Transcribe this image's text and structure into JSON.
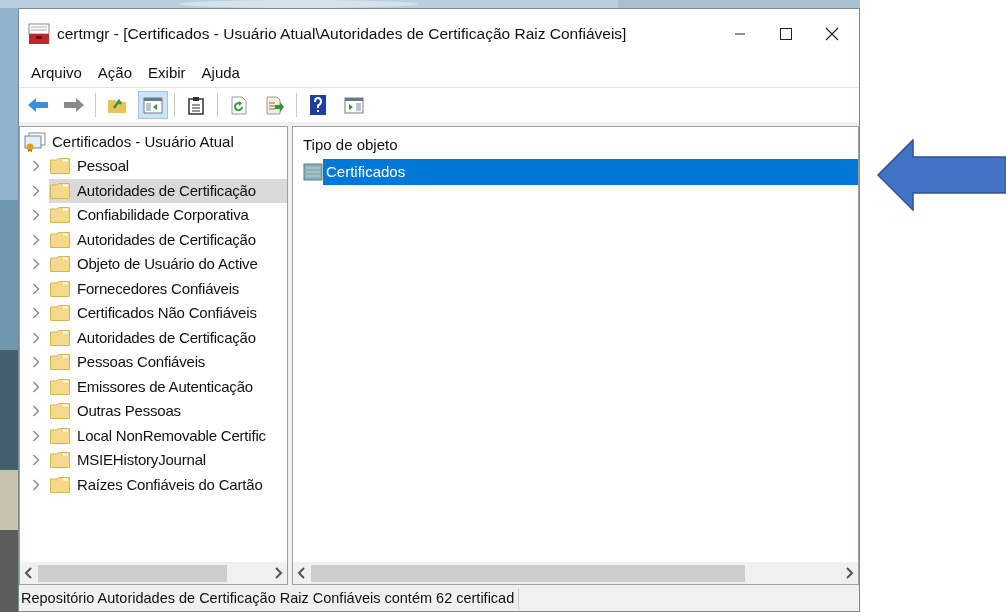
{
  "window": {
    "title": "certmgr - [Certificados - Usuário Atual\\Autoridades de Certificação Raiz Confiáveis]"
  },
  "menu": [
    "Arquivo",
    "Ação",
    "Exibir",
    "Ajuda"
  ],
  "toolbar": [
    {
      "kind": "back",
      "selected": false
    },
    {
      "kind": "forward",
      "selected": false
    },
    {
      "kind": "separator"
    },
    {
      "kind": "up",
      "selected": false
    },
    {
      "kind": "tree",
      "selected": true
    },
    {
      "kind": "separator"
    },
    {
      "kind": "clipboard",
      "selected": false
    },
    {
      "kind": "separator"
    },
    {
      "kind": "refresh",
      "selected": false
    },
    {
      "kind": "export",
      "selected": false
    },
    {
      "kind": "separator"
    },
    {
      "kind": "help",
      "selected": false
    },
    {
      "kind": "actionpane",
      "selected": false
    }
  ],
  "tree": {
    "label": "Certificados - Usuário Atual",
    "children": [
      {
        "label": "Pessoal",
        "selected": false
      },
      {
        "label": "Autoridades de Certificação",
        "selected": true
      },
      {
        "label": "Confiabilidade Corporativa",
        "selected": false
      },
      {
        "label": "Autoridades de Certificação",
        "selected": false
      },
      {
        "label": "Objeto de Usuário do Active",
        "selected": false
      },
      {
        "label": "Fornecedores Confiáveis",
        "selected": false
      },
      {
        "label": "Certificados Não Confiáveis",
        "selected": false
      },
      {
        "label": "Autoridades de Certificação",
        "selected": false
      },
      {
        "label": "Pessoas Confiáveis",
        "selected": false
      },
      {
        "label": "Emissores de Autenticação",
        "selected": false
      },
      {
        "label": "Outras Pessoas",
        "selected": false
      },
      {
        "label": "Local NonRemovable Certific",
        "selected": false
      },
      {
        "label": "MSIEHistoryJournal",
        "selected": false
      },
      {
        "label": "Raízes Confiáveis do Cartão",
        "selected": false
      }
    ]
  },
  "list": {
    "columns": [
      "Tipo de objeto"
    ],
    "rows": [
      {
        "label": "Certificados",
        "selected": true
      }
    ]
  },
  "status_bar": "Repositório Autoridades de Certificação Raiz Confiáveis contém 62 certificad"
}
